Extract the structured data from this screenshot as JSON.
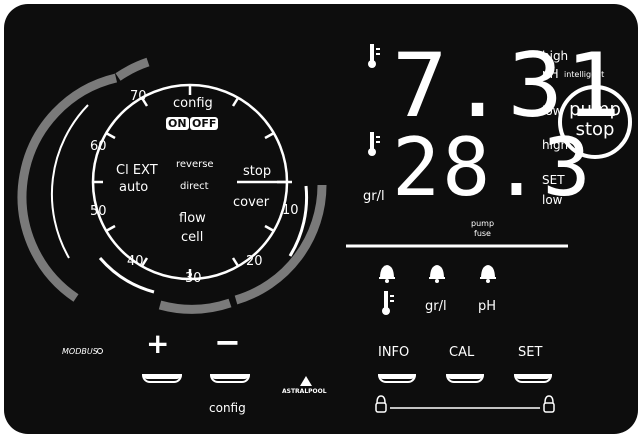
{
  "dial": {
    "scale_labels": [
      "70",
      "60",
      "50",
      "40",
      "30",
      "20",
      "10"
    ],
    "config_label": "config",
    "on_label": "ON",
    "off_label": "OFF",
    "ciext_label": "Cl EXT",
    "auto_label": "auto",
    "reverse_label": "reverse",
    "direct_label": "direct",
    "stop_label": "stop",
    "cover_label": "cover",
    "flow_label": "flow",
    "cell_label": "cell"
  },
  "readings": {
    "ph_digits": "7.31",
    "ph_high": "high",
    "ph_label": "pH",
    "intelligent_label": "intelligent",
    "ph_low": "low",
    "temp_digits": "28.3",
    "temp_high": "high",
    "set_label": "SET",
    "temp_low": "low",
    "grl_unit": "gr/l",
    "pump_fuse_line1": "pump",
    "pump_fuse_line2": "fuse"
  },
  "pump_stop": {
    "line1": "pump",
    "line2": "stop"
  },
  "alarms": {
    "items": [
      {
        "icon": "thermometer-icon",
        "label": ""
      },
      {
        "icon": "gr-l",
        "label": "gr/l"
      },
      {
        "icon": "ph",
        "label": "pH"
      }
    ]
  },
  "controls": {
    "modbus_label": "MODBUS",
    "plus_symbol": "+",
    "minus_symbol": "−",
    "config_label": "config",
    "brand_label": "ASTRALPOOL",
    "info_label": "INFO",
    "cal_label": "CAL",
    "set_label": "SET"
  },
  "colors": {
    "background": "#0d0d0d",
    "foreground": "#ffffff",
    "inactive_segment": "#7a7a7a"
  }
}
